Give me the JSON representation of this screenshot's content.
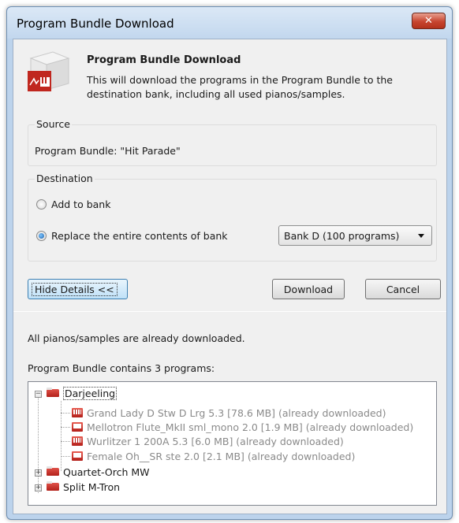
{
  "window": {
    "title": "Program Bundle Download",
    "close_label": "✕"
  },
  "header": {
    "title": "Program Bundle Download",
    "description": "This will download the programs in the Program Bundle to the destination bank, including all used pianos/samples."
  },
  "source": {
    "group_label": "Source",
    "text": "Program Bundle: \"Hit Parade\""
  },
  "destination": {
    "group_label": "Destination",
    "option_add": "Add to bank",
    "option_replace": "Replace the entire contents of bank",
    "selected_option": "replace",
    "bank_selected": "Bank D (100 programs)"
  },
  "buttons": {
    "hide_details": "Hide Details <<",
    "download": "Download",
    "cancel": "Cancel"
  },
  "details": {
    "info": "All pianos/samples are already downloaded.",
    "contains": "Program Bundle contains 3 programs:"
  },
  "tree": {
    "programs": [
      {
        "name": "Darjeeling",
        "expanded": true,
        "children": [
          {
            "icon": "piano-icon",
            "text": "Grand Lady D   Stw D  Lrg 5.3 [78.6 MB] (already downloaded)"
          },
          {
            "icon": "sample-icon",
            "text": "Mellotron Flute_MkII sml_mono 2.0 [1.9 MB] (already downloaded)"
          },
          {
            "icon": "piano-icon",
            "text": "Wurlitzer 1 200A 5.3 [6.0 MB] (already downloaded)"
          },
          {
            "icon": "sample-icon",
            "text": "Female Oh__SR ste 2.0 [2.1 MB] (already downloaded)"
          }
        ]
      },
      {
        "name": "Quartet-Orch  MW",
        "expanded": false,
        "children": []
      },
      {
        "name": "Split M-Tron",
        "expanded": false,
        "children": []
      }
    ]
  },
  "colors": {
    "accent_red": "#c0271f",
    "titlebar": "#c2d7ee",
    "close_button": "#c7452f"
  }
}
